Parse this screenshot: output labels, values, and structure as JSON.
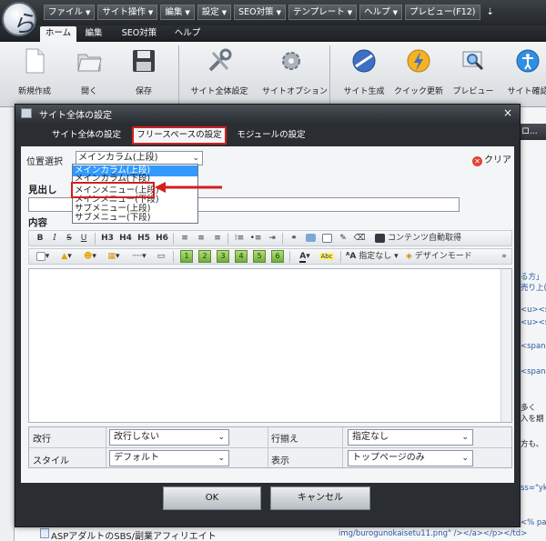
{
  "app": {
    "logo_letter": "ら",
    "menus": [
      "ファイル",
      "サイト操作",
      "編集",
      "設定",
      "SEO対策",
      "テンプレート",
      "ヘルプ",
      "プレビュー(F12)"
    ],
    "menu_overflow": "⇣",
    "ribbon_tabs": [
      "ホーム",
      "編集",
      "SEO対策",
      "ヘルプ"
    ],
    "ribbon_buttons": [
      "新規作成",
      "開く",
      "保存",
      "サイト全体設定",
      "サイトオプション",
      "サイト生成",
      "クイック更新",
      "プレビュー",
      "サイト確認"
    ]
  },
  "background": {
    "right_header": "ロ...",
    "right_code": [
      "る方」",
      "売り上(",
      "<u><s",
      "<u><s",
      "<span",
      "<span",
      "多く",
      "入を期",
      "方も、",
      "ss=\"yk",
      "<% pa"
    ],
    "tree_item": "ASPアダルトのSBS/副業アフィリエイト",
    "code_bottom": "img/burogunokaisetu11.png\" /></a></p></td>"
  },
  "dialog": {
    "title": "サイト全体の設定",
    "close": "×",
    "tabs": [
      "サイト全体の設定",
      "フリースペースの設定",
      "モジュールの設定"
    ],
    "active_tab": "フリースペースの設定",
    "position_label": "位置選択",
    "position_value": "メインカラム(上段)",
    "position_options": [
      "メインカラム(上段)",
      "メインカラム(下段)",
      "メインメニュー(上段)",
      "メインメニュー(下段)",
      "サブメニュー(上段)",
      "サブメニュー(下段)"
    ],
    "highlighted_option": "メインメニュー(上段)",
    "clear_label": "クリア",
    "heading_label": "見出し",
    "content_label": "内容",
    "toolbar1": {
      "buttons": [
        "B",
        "I",
        "S",
        "U",
        "H3",
        "H4",
        "H5",
        "H6"
      ],
      "auto_content": "コンテンツ自動取得"
    },
    "toolbar2": {
      "numbers": [
        "1",
        "2",
        "3",
        "4",
        "5",
        "6"
      ],
      "text_color": "A",
      "abc": "Abc",
      "none_label": "指定なし",
      "design_mode": "デザインモード",
      "more": "»"
    },
    "props": {
      "linebreak_label": "改行",
      "linebreak_value": "改行しない",
      "align_label": "行揃え",
      "align_value": "指定なし",
      "style_label": "スタイル",
      "style_value": "デフォルト",
      "display_label": "表示",
      "display_value": "トップページのみ"
    },
    "ok": "OK",
    "cancel": "キャンセル"
  },
  "colors": {
    "highlight_red": "#d21f1f",
    "selection_blue": "#3399ff"
  }
}
